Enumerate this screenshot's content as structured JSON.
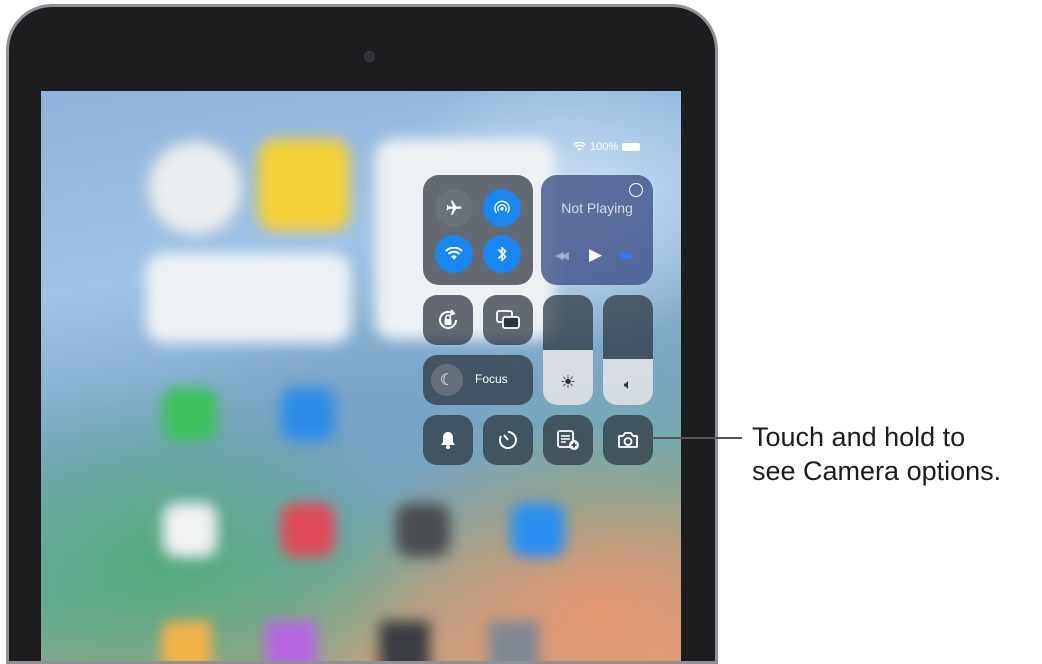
{
  "status_bar": {
    "battery": "100%"
  },
  "control_center": {
    "now_playing": {
      "title": "Not Playing"
    },
    "focus": {
      "label": "Focus"
    },
    "brightness_level": 0.5,
    "volume_level": 0.42
  },
  "callout": {
    "line1": "Touch and hold to",
    "line2": "see Camera options."
  },
  "colors": {
    "accent_blue": "#1a86f0",
    "media_blue": "#3478f6"
  }
}
